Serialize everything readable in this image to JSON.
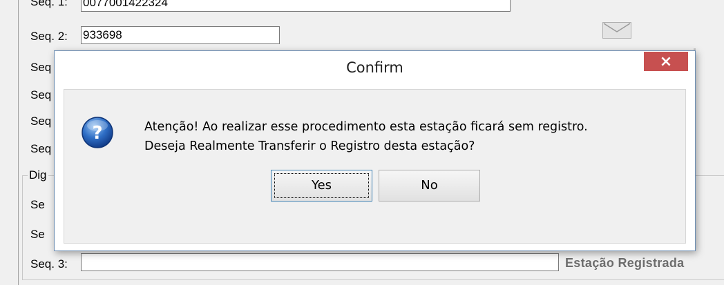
{
  "form": {
    "seq1_label": "Seq. 1:",
    "seq1_value": "0077001422324",
    "seq2_label": "Seq. 2:",
    "seq2_value": "933698",
    "seq3_label": "Seq. 3:",
    "seq_partial_label": "Seq",
    "seq_partial_label_short": "Se",
    "group_title": "Dig",
    "seq3_bottom_label": "Seq. 3:",
    "seq3_bottom_value": "",
    "status_text": "Estação Registrada"
  },
  "dialog": {
    "title": "Confirm",
    "close_label": "×",
    "message_line1": "Atenção! Ao realizar esse procedimento esta estação ficará sem registro.",
    "message_line2": "Deseja Realmente Transferir o Registro desta estação?",
    "yes_label": "Yes",
    "no_label": "No"
  },
  "colors": {
    "close_button": "#c75050",
    "dialog_border": "#6f8fb3",
    "status_text": "#6d6d6d"
  },
  "icons": {
    "dialog_icon": "question-icon",
    "mail": "envelope-icon"
  }
}
